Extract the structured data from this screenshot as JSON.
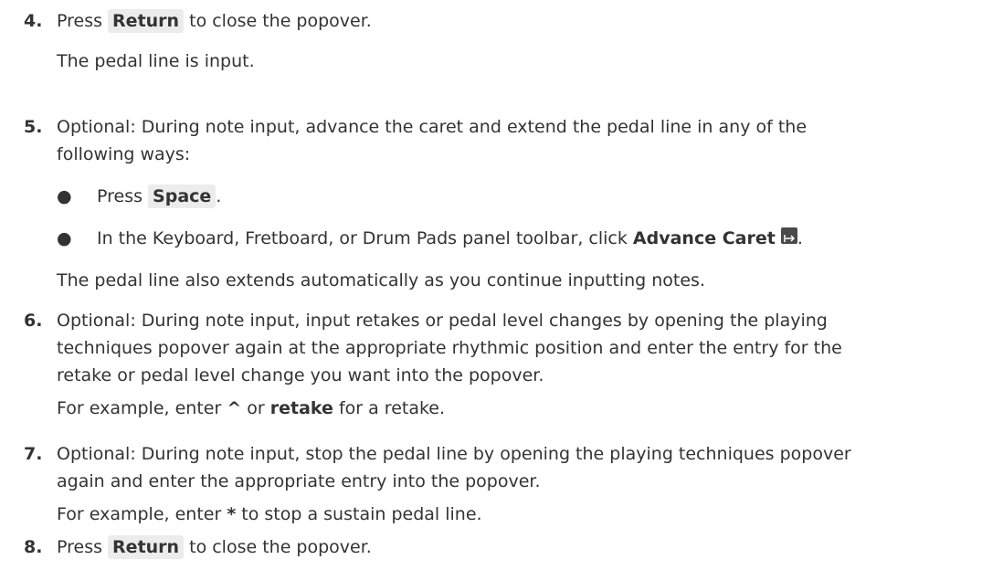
{
  "steps": [
    {
      "number": "4.",
      "pre": "Press ",
      "key": "Return",
      "post": " to close the popover.",
      "result": "The pedal line is input."
    },
    {
      "number": "5.",
      "line1": "Optional: During note input, advance the caret and extend the pedal line in any of the",
      "line2": "following ways:",
      "bullets": [
        {
          "pre": "Press ",
          "key": "Space",
          "post": "."
        },
        {
          "pre": "In the Keyboard, Fretboard, or Drum Pads panel toolbar, click ",
          "bold": "Advance Caret",
          "icon": "advance-caret-icon",
          "post": "."
        }
      ],
      "result": "The pedal line also extends automatically as you continue inputting notes."
    },
    {
      "number": "6.",
      "line1": "Optional: During note input, input retakes or pedal level changes by opening the playing",
      "line2": "techniques popover again at the appropriate rhythmic position and enter the entry for the",
      "line3": "retake or pedal level change you want into the popover.",
      "example_pre": "For example, enter ",
      "example_b1": "^",
      "example_mid": " or ",
      "example_b2": "retake",
      "example_post": " for a retake."
    },
    {
      "number": "7.",
      "line1": "Optional: During note input, stop the pedal line by opening the playing techniques popover",
      "line2": "again and enter the appropriate entry into the popover.",
      "example_pre": "For example, enter ",
      "example_b1": "*",
      "example_post": " to stop a sustain pedal line."
    },
    {
      "number": "8.",
      "pre": "Press ",
      "key": "Return",
      "post": " to close the popover."
    }
  ],
  "bullet_glyph": "●"
}
